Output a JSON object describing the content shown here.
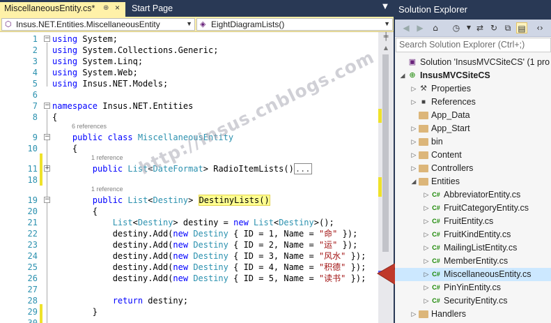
{
  "tabs": [
    {
      "label": "MiscellaneousEntity.cs*",
      "pin": "⊕",
      "close": "×",
      "active": true
    },
    {
      "label": "Start Page",
      "active": false
    }
  ],
  "tab_dropdown": "▼",
  "navbar": {
    "type_combo": "Insus.NET.Entities.MiscellaneousEntity",
    "member_combo": "EightDiagramLists()"
  },
  "code_lines": [
    {
      "n": "1",
      "text": [
        [
          "kw",
          "using"
        ],
        [
          "",
          "System;"
        ]
      ]
    },
    {
      "n": "2",
      "text": [
        [
          "kw",
          "using"
        ],
        [
          "",
          "System.Collections.Generic;"
        ]
      ]
    },
    {
      "n": "3",
      "text": [
        [
          "kw",
          "using"
        ],
        [
          "",
          "System.Linq;"
        ]
      ]
    },
    {
      "n": "4",
      "text": [
        [
          "kw",
          "using"
        ],
        [
          "",
          "System.Web;"
        ]
      ]
    },
    {
      "n": "5",
      "text": [
        [
          "kw",
          "using"
        ],
        [
          "",
          "Insus.NET.Models;"
        ]
      ]
    },
    {
      "n": "6",
      "text": []
    },
    {
      "n": "7",
      "text": [
        [
          "kw",
          "namespace"
        ],
        [
          "",
          " Insus.NET.Entities"
        ]
      ]
    },
    {
      "n": "8",
      "text": [
        [
          "",
          "{"
        ]
      ]
    },
    {
      "n": "9",
      "text": [
        [
          "",
          "    "
        ],
        [
          "kw",
          "public class"
        ],
        [
          "",
          ""
        ],
        [
          "ty",
          " MiscellaneousEntity"
        ]
      ]
    },
    {
      "n": "10",
      "text": [
        [
          "",
          "    {"
        ]
      ]
    },
    {
      "n": "11",
      "text": [
        [
          "",
          "        "
        ],
        [
          "kw",
          "public"
        ],
        [
          "",
          " "
        ],
        [
          "ty",
          "List"
        ],
        [
          "",
          "<"
        ],
        [
          "ty",
          "DateFormat"
        ],
        [
          "",
          "> RadioItemLists()"
        ],
        [
          "collapsed",
          "..."
        ]
      ]
    },
    {
      "n": "18",
      "text": []
    },
    {
      "n": "19",
      "text": [
        [
          "",
          "        "
        ],
        [
          "kw",
          "public"
        ],
        [
          "",
          " "
        ],
        [
          "ty",
          "List"
        ],
        [
          "",
          "<"
        ],
        [
          "ty",
          "Destiny"
        ],
        [
          "",
          "> "
        ],
        [
          "hl",
          "DestinyLists()"
        ]
      ]
    },
    {
      "n": "20",
      "text": [
        [
          "",
          "        {"
        ]
      ]
    },
    {
      "n": "21",
      "text": [
        [
          "",
          "            "
        ],
        [
          "ty",
          "List"
        ],
        [
          "",
          "<"
        ],
        [
          "ty",
          "Destiny"
        ],
        [
          "",
          "> destiny = "
        ],
        [
          "kw",
          "new"
        ],
        [
          "",
          " "
        ],
        [
          "ty",
          "List"
        ],
        [
          "",
          "<"
        ],
        [
          "ty",
          "Destiny"
        ],
        [
          "",
          ">();"
        ]
      ]
    },
    {
      "n": "22",
      "text": [
        [
          "",
          "            destiny.Add("
        ],
        [
          "kw",
          "new"
        ],
        [
          "",
          " "
        ],
        [
          "ty",
          "Destiny"
        ],
        [
          "",
          " { ID = 1, Name = "
        ],
        [
          "st",
          "\"命\""
        ],
        [
          "",
          " });"
        ]
      ]
    },
    {
      "n": "23",
      "text": [
        [
          "",
          "            destiny.Add("
        ],
        [
          "kw",
          "new"
        ],
        [
          "",
          " "
        ],
        [
          "ty",
          "Destiny"
        ],
        [
          "",
          " { ID = 2, Name = "
        ],
        [
          "st",
          "\"运\""
        ],
        [
          "",
          " });"
        ]
      ]
    },
    {
      "n": "24",
      "text": [
        [
          "",
          "            destiny.Add("
        ],
        [
          "kw",
          "new"
        ],
        [
          "",
          " "
        ],
        [
          "ty",
          "Destiny"
        ],
        [
          "",
          " { ID = 3, Name = "
        ],
        [
          "st",
          "\"风水\""
        ],
        [
          "",
          " });"
        ]
      ]
    },
    {
      "n": "25",
      "text": [
        [
          "",
          "            destiny.Add("
        ],
        [
          "kw",
          "new"
        ],
        [
          "",
          " "
        ],
        [
          "ty",
          "Destiny"
        ],
        [
          "",
          " { ID = 4, Name = "
        ],
        [
          "st",
          "\"积德\""
        ],
        [
          "",
          " });"
        ]
      ]
    },
    {
      "n": "26",
      "text": [
        [
          "",
          "            destiny.Add("
        ],
        [
          "kw",
          "new"
        ],
        [
          "",
          " "
        ],
        [
          "ty",
          "Destiny"
        ],
        [
          "",
          " { ID = 5, Name = "
        ],
        [
          "st",
          "\"读书\""
        ],
        [
          "",
          " });"
        ]
      ]
    },
    {
      "n": "27",
      "text": []
    },
    {
      "n": "28",
      "text": [
        [
          "",
          "            "
        ],
        [
          "kw",
          "return"
        ],
        [
          "",
          " destiny;"
        ]
      ]
    },
    {
      "n": "29",
      "text": [
        [
          "",
          "        }"
        ]
      ]
    },
    {
      "n": "30",
      "text": []
    }
  ],
  "code_lens": [
    "6 references",
    "1 reference",
    "1 reference"
  ],
  "watermark": "http://insus.cnblogs.com",
  "solution_explorer": {
    "title": "Solution Explorer",
    "search_placeholder": "Search Solution Explorer (Ctrl+;)",
    "tree": [
      {
        "label": "Solution 'InsusMVCSiteCS' (1 pro",
        "icon": "solution-icon",
        "depth": 0,
        "expander": ""
      },
      {
        "label": "InsusMVCSiteCS",
        "icon": "project-icon",
        "depth": 1,
        "expander": "◢",
        "bold": true
      },
      {
        "label": "Properties",
        "icon": "properties-icon",
        "depth": 2,
        "expander": "▷"
      },
      {
        "label": "References",
        "icon": "references-icon",
        "depth": 2,
        "expander": "▷"
      },
      {
        "label": "App_Data",
        "icon": "folder-icon",
        "depth": 2,
        "expander": ""
      },
      {
        "label": "App_Start",
        "icon": "folder-icon",
        "depth": 2,
        "expander": "▷"
      },
      {
        "label": "bin",
        "icon": "folder-icon",
        "depth": 2,
        "expander": "▷"
      },
      {
        "label": "Content",
        "icon": "folder-icon",
        "depth": 2,
        "expander": "▷"
      },
      {
        "label": "Controllers",
        "icon": "folder-icon",
        "depth": 2,
        "expander": "▷"
      },
      {
        "label": "Entities",
        "icon": "folder-icon",
        "depth": 2,
        "expander": "◢"
      },
      {
        "label": "AbbreviatorEntity.cs",
        "icon": "csharp-file-icon",
        "depth": 3,
        "expander": "▷"
      },
      {
        "label": "FruitCategoryEntity.cs",
        "icon": "csharp-file-icon",
        "depth": 3,
        "expander": "▷"
      },
      {
        "label": "FruitEntity.cs",
        "icon": "csharp-file-icon",
        "depth": 3,
        "expander": "▷"
      },
      {
        "label": "FruitKindEntity.cs",
        "icon": "csharp-file-icon",
        "depth": 3,
        "expander": "▷"
      },
      {
        "label": "MailingListEntity.cs",
        "icon": "csharp-file-icon",
        "depth": 3,
        "expander": "▷"
      },
      {
        "label": "MemberEntity.cs",
        "icon": "csharp-file-icon",
        "depth": 3,
        "expander": "▷"
      },
      {
        "label": "MiscellaneousEntity.cs",
        "icon": "csharp-file-icon",
        "depth": 3,
        "expander": "▷",
        "selected": true
      },
      {
        "label": "PinYinEntity.cs",
        "icon": "csharp-file-icon",
        "depth": 3,
        "expander": "▷"
      },
      {
        "label": "SecurityEntity.cs",
        "icon": "csharp-file-icon",
        "depth": 3,
        "expander": "▷"
      },
      {
        "label": "Handlers",
        "icon": "folder-icon",
        "depth": 2,
        "expander": "▷"
      }
    ]
  },
  "colors": {
    "accent": "#293955",
    "tab_active": "#fff1a8",
    "selection": "#cce8ff",
    "change_marker": "#efe22a",
    "arrow": "#c0392b"
  }
}
